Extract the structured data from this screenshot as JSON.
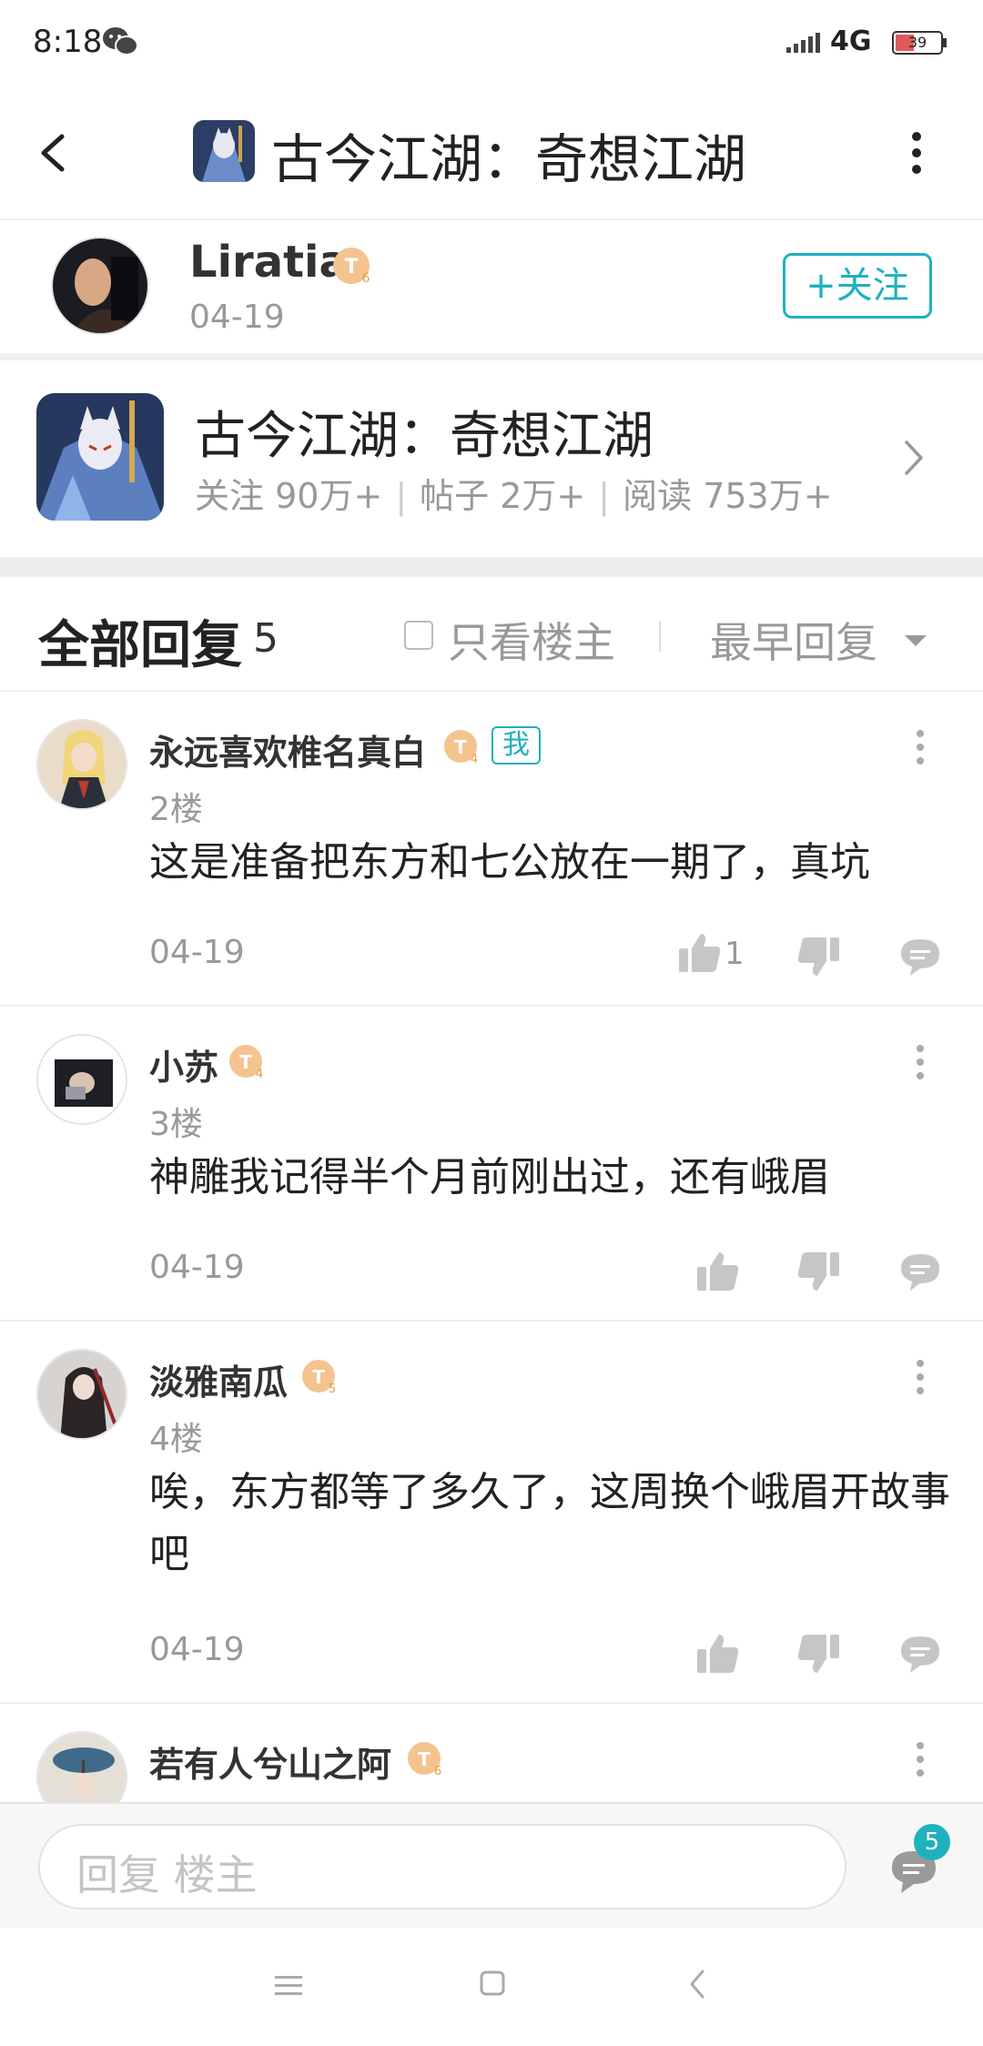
{
  "status_bar": {
    "time": "8:18",
    "network": "4G",
    "battery": "39"
  },
  "header": {
    "title": "古今江湖：奇想江湖"
  },
  "author": {
    "name": "Liratia",
    "date": "04-19",
    "follow_label": "+关注"
  },
  "forum": {
    "name": "古今江湖：奇想江湖",
    "stats": [
      {
        "label": "关注",
        "value": "90万+"
      },
      {
        "label": "帖子",
        "value": "2万+"
      },
      {
        "label": "阅读",
        "value": "753万+"
      }
    ]
  },
  "replies_header": {
    "title": "全部回复",
    "count": "5",
    "op_only_label": "只看楼主",
    "sort_label": "最早回复"
  },
  "replies": [
    {
      "name": "永远喜欢椎名真白",
      "level": "4",
      "me_tag": "我",
      "floor": "2楼",
      "content": "这是准备把东方和七公放在一期了，真坑",
      "date": "04-19",
      "likes": "1"
    },
    {
      "name": "小苏",
      "level": "4",
      "floor": "3楼",
      "content": "神雕我记得半个月前刚出过，还有峨眉",
      "date": "04-19"
    },
    {
      "name": "淡雅南瓜",
      "level": "5",
      "floor": "4楼",
      "content": "唉，东方都等了多久了，这周换个峨眉开故事吧",
      "date": "04-19"
    },
    {
      "name": "若有人兮山之阿",
      "level": "6"
    }
  ],
  "reply_bar": {
    "placeholder": "回复  楼主",
    "comment_count": "5"
  },
  "colors": {
    "accent": "#1fb1be",
    "badge": "#f5c48e",
    "text_gray": "#999999"
  }
}
